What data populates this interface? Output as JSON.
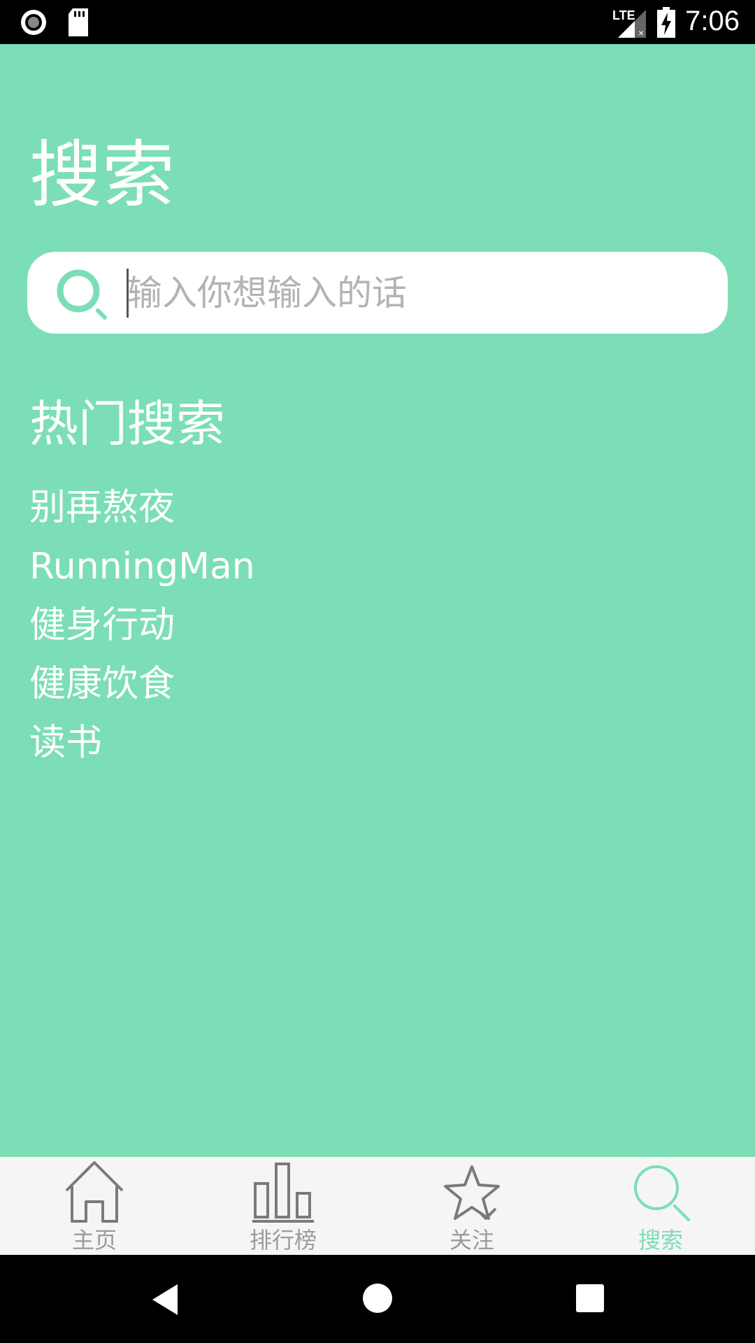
{
  "status_bar": {
    "time": "7:06",
    "network": "LTE",
    "icons": [
      "record-icon",
      "sd-card-icon",
      "signal-icon",
      "battery-charging-icon"
    ]
  },
  "page": {
    "title": "搜索"
  },
  "search": {
    "placeholder": "输入你想输入的话",
    "value": "",
    "icon": "search-icon"
  },
  "hot": {
    "title": "热门搜索",
    "items": [
      "别再熬夜",
      "RunningMan",
      "健身行动",
      "健康饮食",
      "读书"
    ]
  },
  "bottom_nav": {
    "items": [
      {
        "label": "主页",
        "icon": "home-icon",
        "active": false
      },
      {
        "label": "排行榜",
        "icon": "bar-chart-icon",
        "active": false
      },
      {
        "label": "关注",
        "icon": "star-icon",
        "active": false
      },
      {
        "label": "搜索",
        "icon": "search-icon",
        "active": true
      }
    ]
  },
  "colors": {
    "background": "#7bdeb6",
    "accent": "#7bdeb6",
    "nav_inactive": "#9b9b9b",
    "nav_bg": "#f5f5f5"
  }
}
